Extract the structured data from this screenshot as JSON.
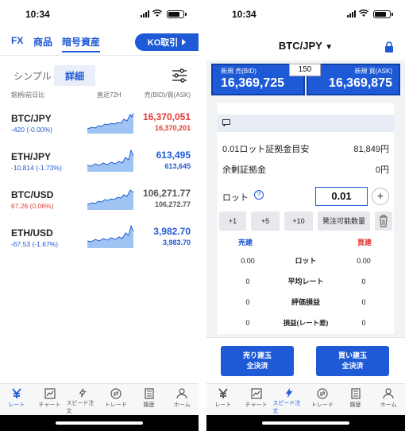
{
  "left": {
    "status_time": "10:34",
    "nav": {
      "fx": "FX",
      "commodity": "商品",
      "crypto": "暗号資産",
      "ko_button": "KO取引"
    },
    "modes": {
      "simple": "シンプル",
      "detail": "詳細"
    },
    "columns": {
      "symbol": "銘柄/前日比",
      "chart": "直近72H",
      "price": "売(BID)/買(ASK)"
    },
    "rows": [
      {
        "symbol": "BTC/JPY",
        "change": "-420 (-0.00%)",
        "change_dir": "down",
        "bid": "16,370,051",
        "ask": "16,370,201",
        "price_dir": "up"
      },
      {
        "symbol": "ETH/JPY",
        "change": "-10,814 (-1.73%)",
        "change_dir": "down",
        "bid": "613,495",
        "ask": "613,645",
        "price_dir": "down"
      },
      {
        "symbol": "BTC/USD",
        "change": "67.26 (0.06%)",
        "change_dir": "up",
        "bid": "106,271.77",
        "ask": "106,272.77",
        "price_dir": "neutral"
      },
      {
        "symbol": "ETH/USD",
        "change": "-67.53 (-1.67%)",
        "change_dir": "down",
        "bid": "3,982.70",
        "ask": "3,983.70",
        "price_dir": "down"
      }
    ],
    "tabs": [
      "レート",
      "チャート",
      "スピード注文",
      "トレード",
      "履歴",
      "ホーム"
    ],
    "active_tab": 0
  },
  "right": {
    "status_time": "10:34",
    "pair": "BTC/JPY",
    "bid_label": "新規 売(BID)",
    "bid_value": "16,369,725",
    "ask_label": "新規 買(ASK)",
    "ask_value": "16,369,875",
    "spread": "150",
    "margin_label": "0.01ロット証拠金目安",
    "margin_value": "81,849円",
    "free_margin_label": "余剰証拠金",
    "free_margin_value": "0円",
    "lot_label": "ロット",
    "lot_value": "0.01",
    "quick": [
      "+1",
      "+5",
      "+10",
      "発注可能数量"
    ],
    "sell_title": "売建",
    "buy_title": "買建",
    "grid": [
      {
        "label": "ロット",
        "sell": "0.00",
        "buy": "0.00"
      },
      {
        "label": "平均レート",
        "sell": "0",
        "buy": "0"
      },
      {
        "label": "評価損益",
        "sell": "0",
        "buy": "0"
      },
      {
        "label": "損益(レート差)",
        "sell": "0",
        "buy": "0"
      }
    ],
    "sell_close": [
      "売り建玉",
      "全決済"
    ],
    "buy_close": [
      "買い建玉",
      "全決済"
    ],
    "tabs": [
      "レート",
      "チャート",
      "スピード注文",
      "トレード",
      "履歴",
      "ホーム"
    ],
    "active_tab": 2
  },
  "colors": {
    "accent": "#1e5ad6",
    "up": "#e53935",
    "sell_title": "#1e5ad6",
    "buy_title": "#e53935"
  },
  "icons": {
    "tabs": [
      "yen-icon",
      "chart-icon",
      "lightning-icon",
      "trade-icon",
      "history-icon",
      "home-icon"
    ]
  }
}
